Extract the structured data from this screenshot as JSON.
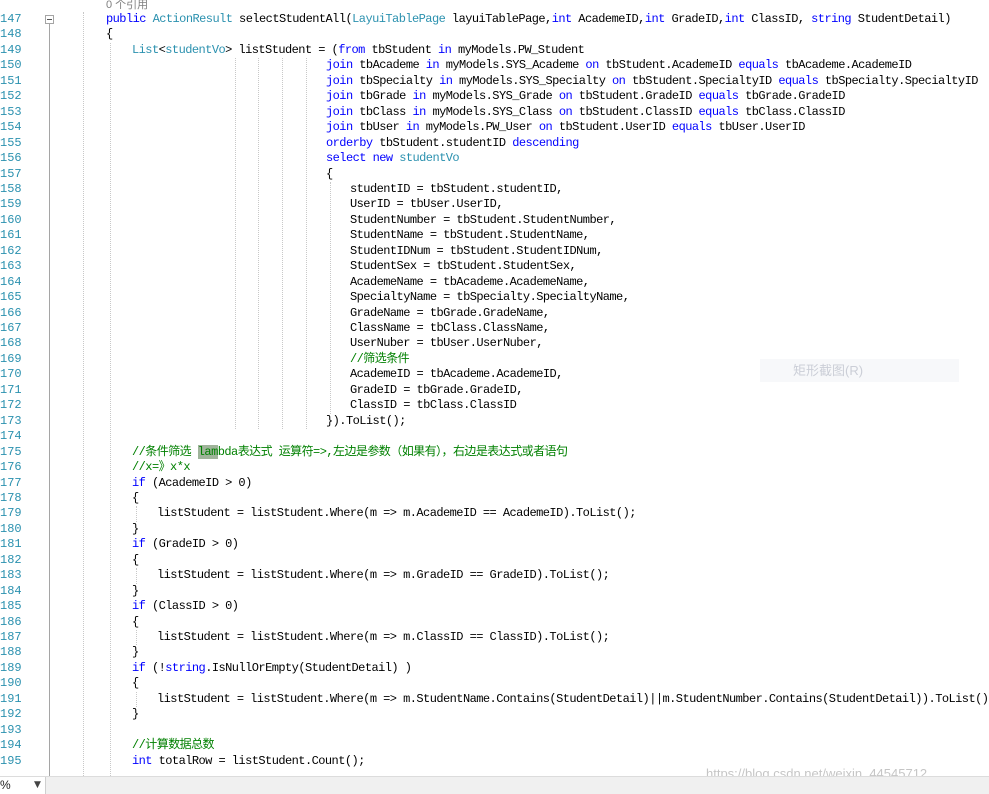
{
  "editor": {
    "codelens": "0 个引用",
    "lines": [
      {
        "n": "147",
        "text": "public ActionResult selectStudentAll(LayuiTablePage layuiTablePage,int AcademeID,int GradeID,int ClassID, string StudentDetail)"
      },
      {
        "n": "148",
        "text": "{"
      },
      {
        "n": "149",
        "text": "List<studentVo> listStudent = (from tbStudent in myModels.PW_Student"
      },
      {
        "n": "150",
        "text": "join tbAcademe in myModels.SYS_Academe on tbStudent.AcademeID equals tbAcademe.AcademeID"
      },
      {
        "n": "151",
        "text": "join tbSpecialty in myModels.SYS_Specialty on tbStudent.SpecialtyID equals tbSpecialty.SpecialtyID"
      },
      {
        "n": "152",
        "text": "join tbGrade in myModels.SYS_Grade on tbStudent.GradeID equals tbGrade.GradeID"
      },
      {
        "n": "153",
        "text": "join tbClass in myModels.SYS_Class on tbStudent.ClassID equals tbClass.ClassID"
      },
      {
        "n": "154",
        "text": "join tbUser in myModels.PW_User on tbStudent.UserID equals tbUser.UserID"
      },
      {
        "n": "155",
        "text": "orderby tbStudent.studentID descending"
      },
      {
        "n": "156",
        "text": "select new studentVo"
      },
      {
        "n": "157",
        "text": "{"
      },
      {
        "n": "158",
        "text": "studentID = tbStudent.studentID,"
      },
      {
        "n": "159",
        "text": "UserID = tbUser.UserID,"
      },
      {
        "n": "160",
        "text": "StudentNumber = tbStudent.StudentNumber,"
      },
      {
        "n": "161",
        "text": "StudentName = tbStudent.StudentName,"
      },
      {
        "n": "162",
        "text": "StudentIDNum = tbStudent.StudentIDNum,"
      },
      {
        "n": "163",
        "text": "StudentSex = tbStudent.StudentSex,"
      },
      {
        "n": "164",
        "text": "AcademeName = tbAcademe.AcademeName,"
      },
      {
        "n": "165",
        "text": "SpecialtyName = tbSpecialty.SpecialtyName,"
      },
      {
        "n": "166",
        "text": "GradeName = tbGrade.GradeName,"
      },
      {
        "n": "167",
        "text": "ClassName = tbClass.ClassName,"
      },
      {
        "n": "168",
        "text": "UserNuber = tbUser.UserNuber,"
      },
      {
        "n": "169",
        "text": "//筛选条件"
      },
      {
        "n": "170",
        "text": "AcademeID = tbAcademe.AcademeID,"
      },
      {
        "n": "171",
        "text": "GradeID = tbGrade.GradeID,"
      },
      {
        "n": "172",
        "text": "ClassID = tbClass.ClassID"
      },
      {
        "n": "173",
        "text": "}).ToList();"
      },
      {
        "n": "174",
        "text": ""
      },
      {
        "n": "175",
        "text": "//条件筛选 lambda表达式 运算符=>,左边是参数（如果有），右边是表达式或者语句"
      },
      {
        "n": "176",
        "text": "//x=》x*x"
      },
      {
        "n": "177",
        "text": "if (AcademeID > 0)"
      },
      {
        "n": "178",
        "text": "{"
      },
      {
        "n": "179",
        "text": "listStudent = listStudent.Where(m => m.AcademeID == AcademeID).ToList();"
      },
      {
        "n": "180",
        "text": "}"
      },
      {
        "n": "181",
        "text": "if (GradeID > 0)"
      },
      {
        "n": "182",
        "text": "{"
      },
      {
        "n": "183",
        "text": "listStudent = listStudent.Where(m => m.GradeID == GradeID).ToList();"
      },
      {
        "n": "184",
        "text": "}"
      },
      {
        "n": "185",
        "text": "if (ClassID > 0)"
      },
      {
        "n": "186",
        "text": "{"
      },
      {
        "n": "187",
        "text": "listStudent = listStudent.Where(m => m.ClassID == ClassID).ToList();"
      },
      {
        "n": "188",
        "text": "}"
      },
      {
        "n": "189",
        "text": "if (!string.IsNullOrEmpty(StudentDetail) )"
      },
      {
        "n": "190",
        "text": "{"
      },
      {
        "n": "191",
        "text": "listStudent = listStudent.Where(m => m.StudentName.Contains(StudentDetail)||m.StudentNumber.Contains(StudentDetail)).ToList();"
      },
      {
        "n": "192",
        "text": "}"
      },
      {
        "n": "193",
        "text": ""
      },
      {
        "n": "194",
        "text": "//计算数据总数"
      },
      {
        "n": "195",
        "text": "int totalRow = listStudent.Count();"
      }
    ]
  },
  "context_menu_ghost": "矩形截图(R)",
  "watermark": "https://blog.csdn.net/weixin_44545712",
  "statusbar": {
    "zoom": "%"
  },
  "colors": {
    "keyword": "#0000ff",
    "type": "#2b91af",
    "comment": "#008000",
    "line_number": "#2b91af",
    "selection_highlight": "#9fb49a"
  }
}
